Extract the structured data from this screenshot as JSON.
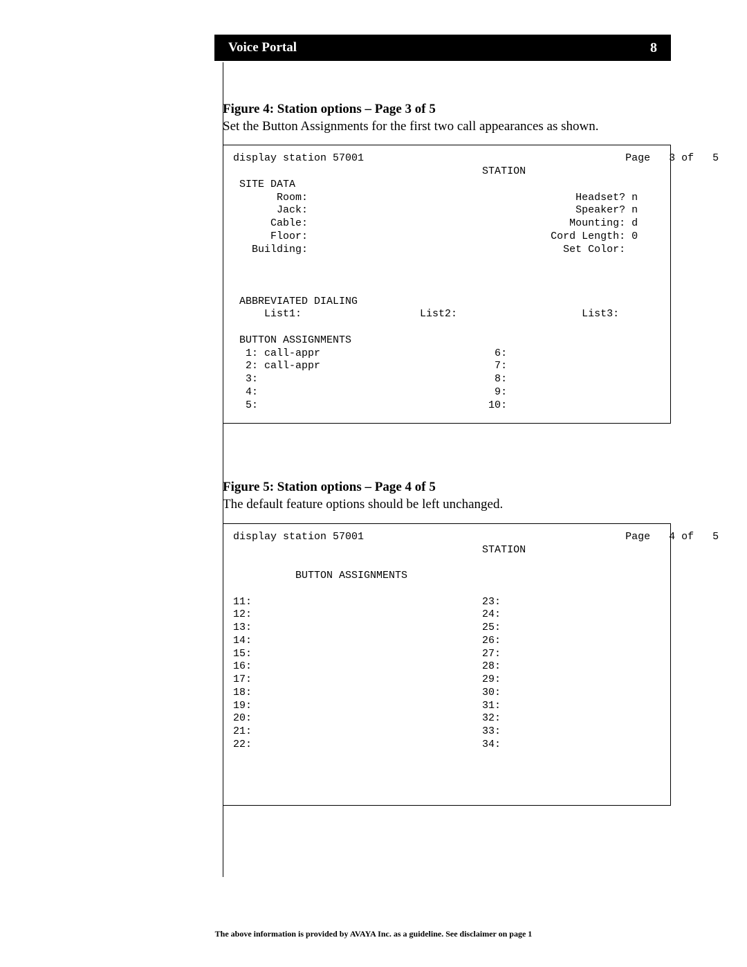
{
  "header": {
    "title": "Voice Portal",
    "page_number": "8"
  },
  "figure4": {
    "caption": "Figure 4: Station options – Page 3 of 5",
    "description": "Set the Button Assignments for the first two call appearances as shown.",
    "terminal": "display station 57001                                          Page   3 of   5\n                                        STATION\n SITE DATA\n       Room:                                           Headset? n\n       Jack:                                           Speaker? n\n      Cable:                                          Mounting: d\n      Floor:                                       Cord Length: 0\n   Building:                                         Set Color:\n\n\n\n ABBREVIATED DIALING\n     List1:                   List2:                    List3:\n\n BUTTON ASSIGNMENTS\n  1: call-appr                            6:\n  2: call-appr                            7:\n  3:                                      8:\n  4:                                      9:\n  5:                                     10:\n"
  },
  "figure5": {
    "caption": "Figure 5: Station options – Page 4 of 5",
    "description": "The default feature options should be left unchanged.",
    "terminal": "display station 57001                                          Page   4 of   5\n                                        STATION\n\n          BUTTON ASSIGNMENTS\n\n11:                                     23:\n12:                                     24:\n13:                                     25:\n14:                                     26:\n15:                                     27:\n16:                                     28:\n17:                                     29:\n18:                                     30:\n19:                                     31:\n20:                                     32:\n21:                                     33:\n22:                                     34:\n\n\n\n"
  },
  "footer": {
    "text": "The above information is provided by AVAYA Inc. as a guideline.  See disclaimer on page 1"
  }
}
